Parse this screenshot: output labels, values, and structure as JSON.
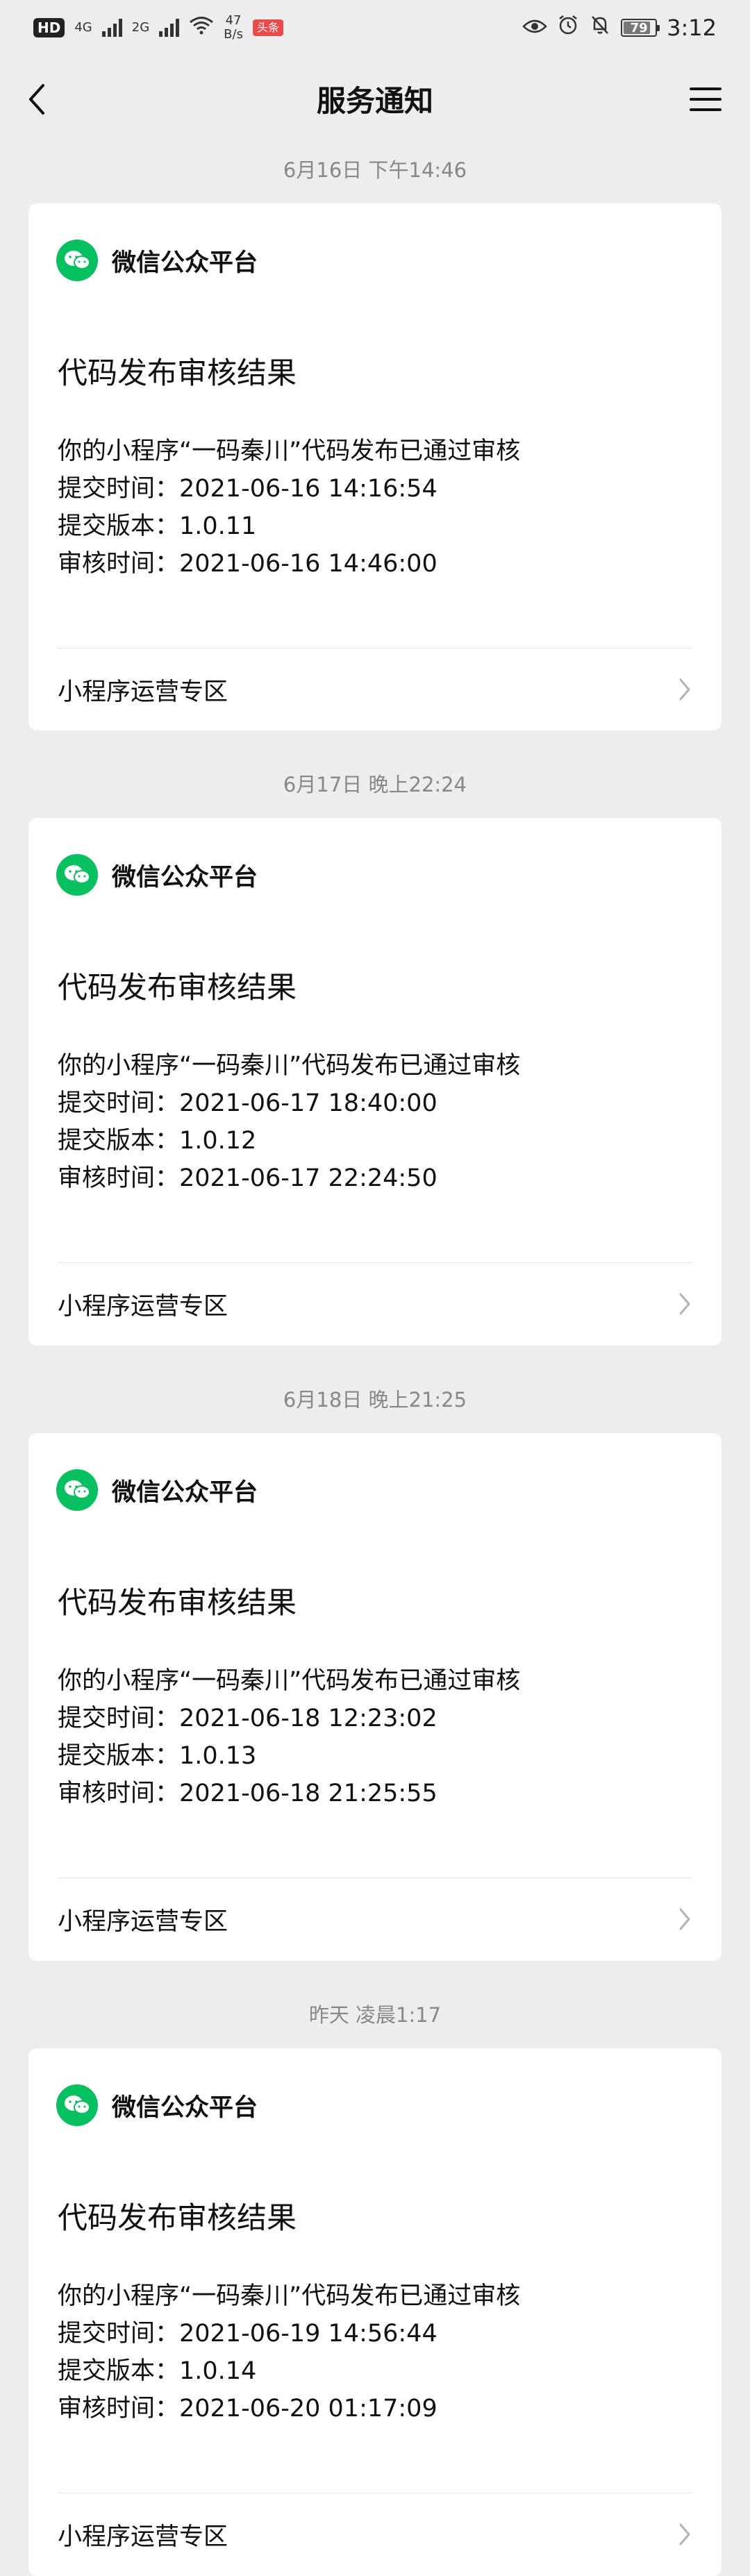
{
  "status_bar": {
    "hd_badge": "HD",
    "net1": "4G",
    "net2": "2G",
    "speed_value": "47",
    "speed_unit": "B/s",
    "red_badge": "头条",
    "battery": "79",
    "time": "3:12"
  },
  "nav": {
    "title": "服务通知"
  },
  "messages": [
    {
      "time": "6月16日 下午14:46",
      "source": "微信公众平台",
      "title": "代码发布审核结果",
      "lines": [
        "你的小程序“一码秦川”代码发布已通过审核",
        "提交时间：2021-06-16 14:16:54",
        "提交版本：1.0.11",
        "审核时间：2021-06-16 14:46:00"
      ],
      "footer": "小程序运营专区"
    },
    {
      "time": "6月17日 晚上22:24",
      "source": "微信公众平台",
      "title": "代码发布审核结果",
      "lines": [
        "你的小程序“一码秦川”代码发布已通过审核",
        "提交时间：2021-06-17 18:40:00",
        "提交版本：1.0.12",
        "审核时间：2021-06-17 22:24:50"
      ],
      "footer": "小程序运营专区"
    },
    {
      "time": "6月18日 晚上21:25",
      "source": "微信公众平台",
      "title": "代码发布审核结果",
      "lines": [
        "你的小程序“一码秦川”代码发布已通过审核",
        "提交时间：2021-06-18 12:23:02",
        "提交版本：1.0.13",
        "审核时间：2021-06-18 21:25:55"
      ],
      "footer": "小程序运营专区"
    },
    {
      "time": "昨天 凌晨1:17",
      "source": "微信公众平台",
      "title": "代码发布审核结果",
      "lines": [
        "你的小程序“一码秦川”代码发布已通过审核",
        "提交时间：2021-06-19 14:56:44",
        "提交版本：1.0.14",
        "审核时间：2021-06-20 01:17:09"
      ],
      "footer": "小程序运营专区"
    }
  ],
  "colors": {
    "background": "#ededed",
    "card": "#ffffff",
    "wechat_green": "#07c160"
  }
}
